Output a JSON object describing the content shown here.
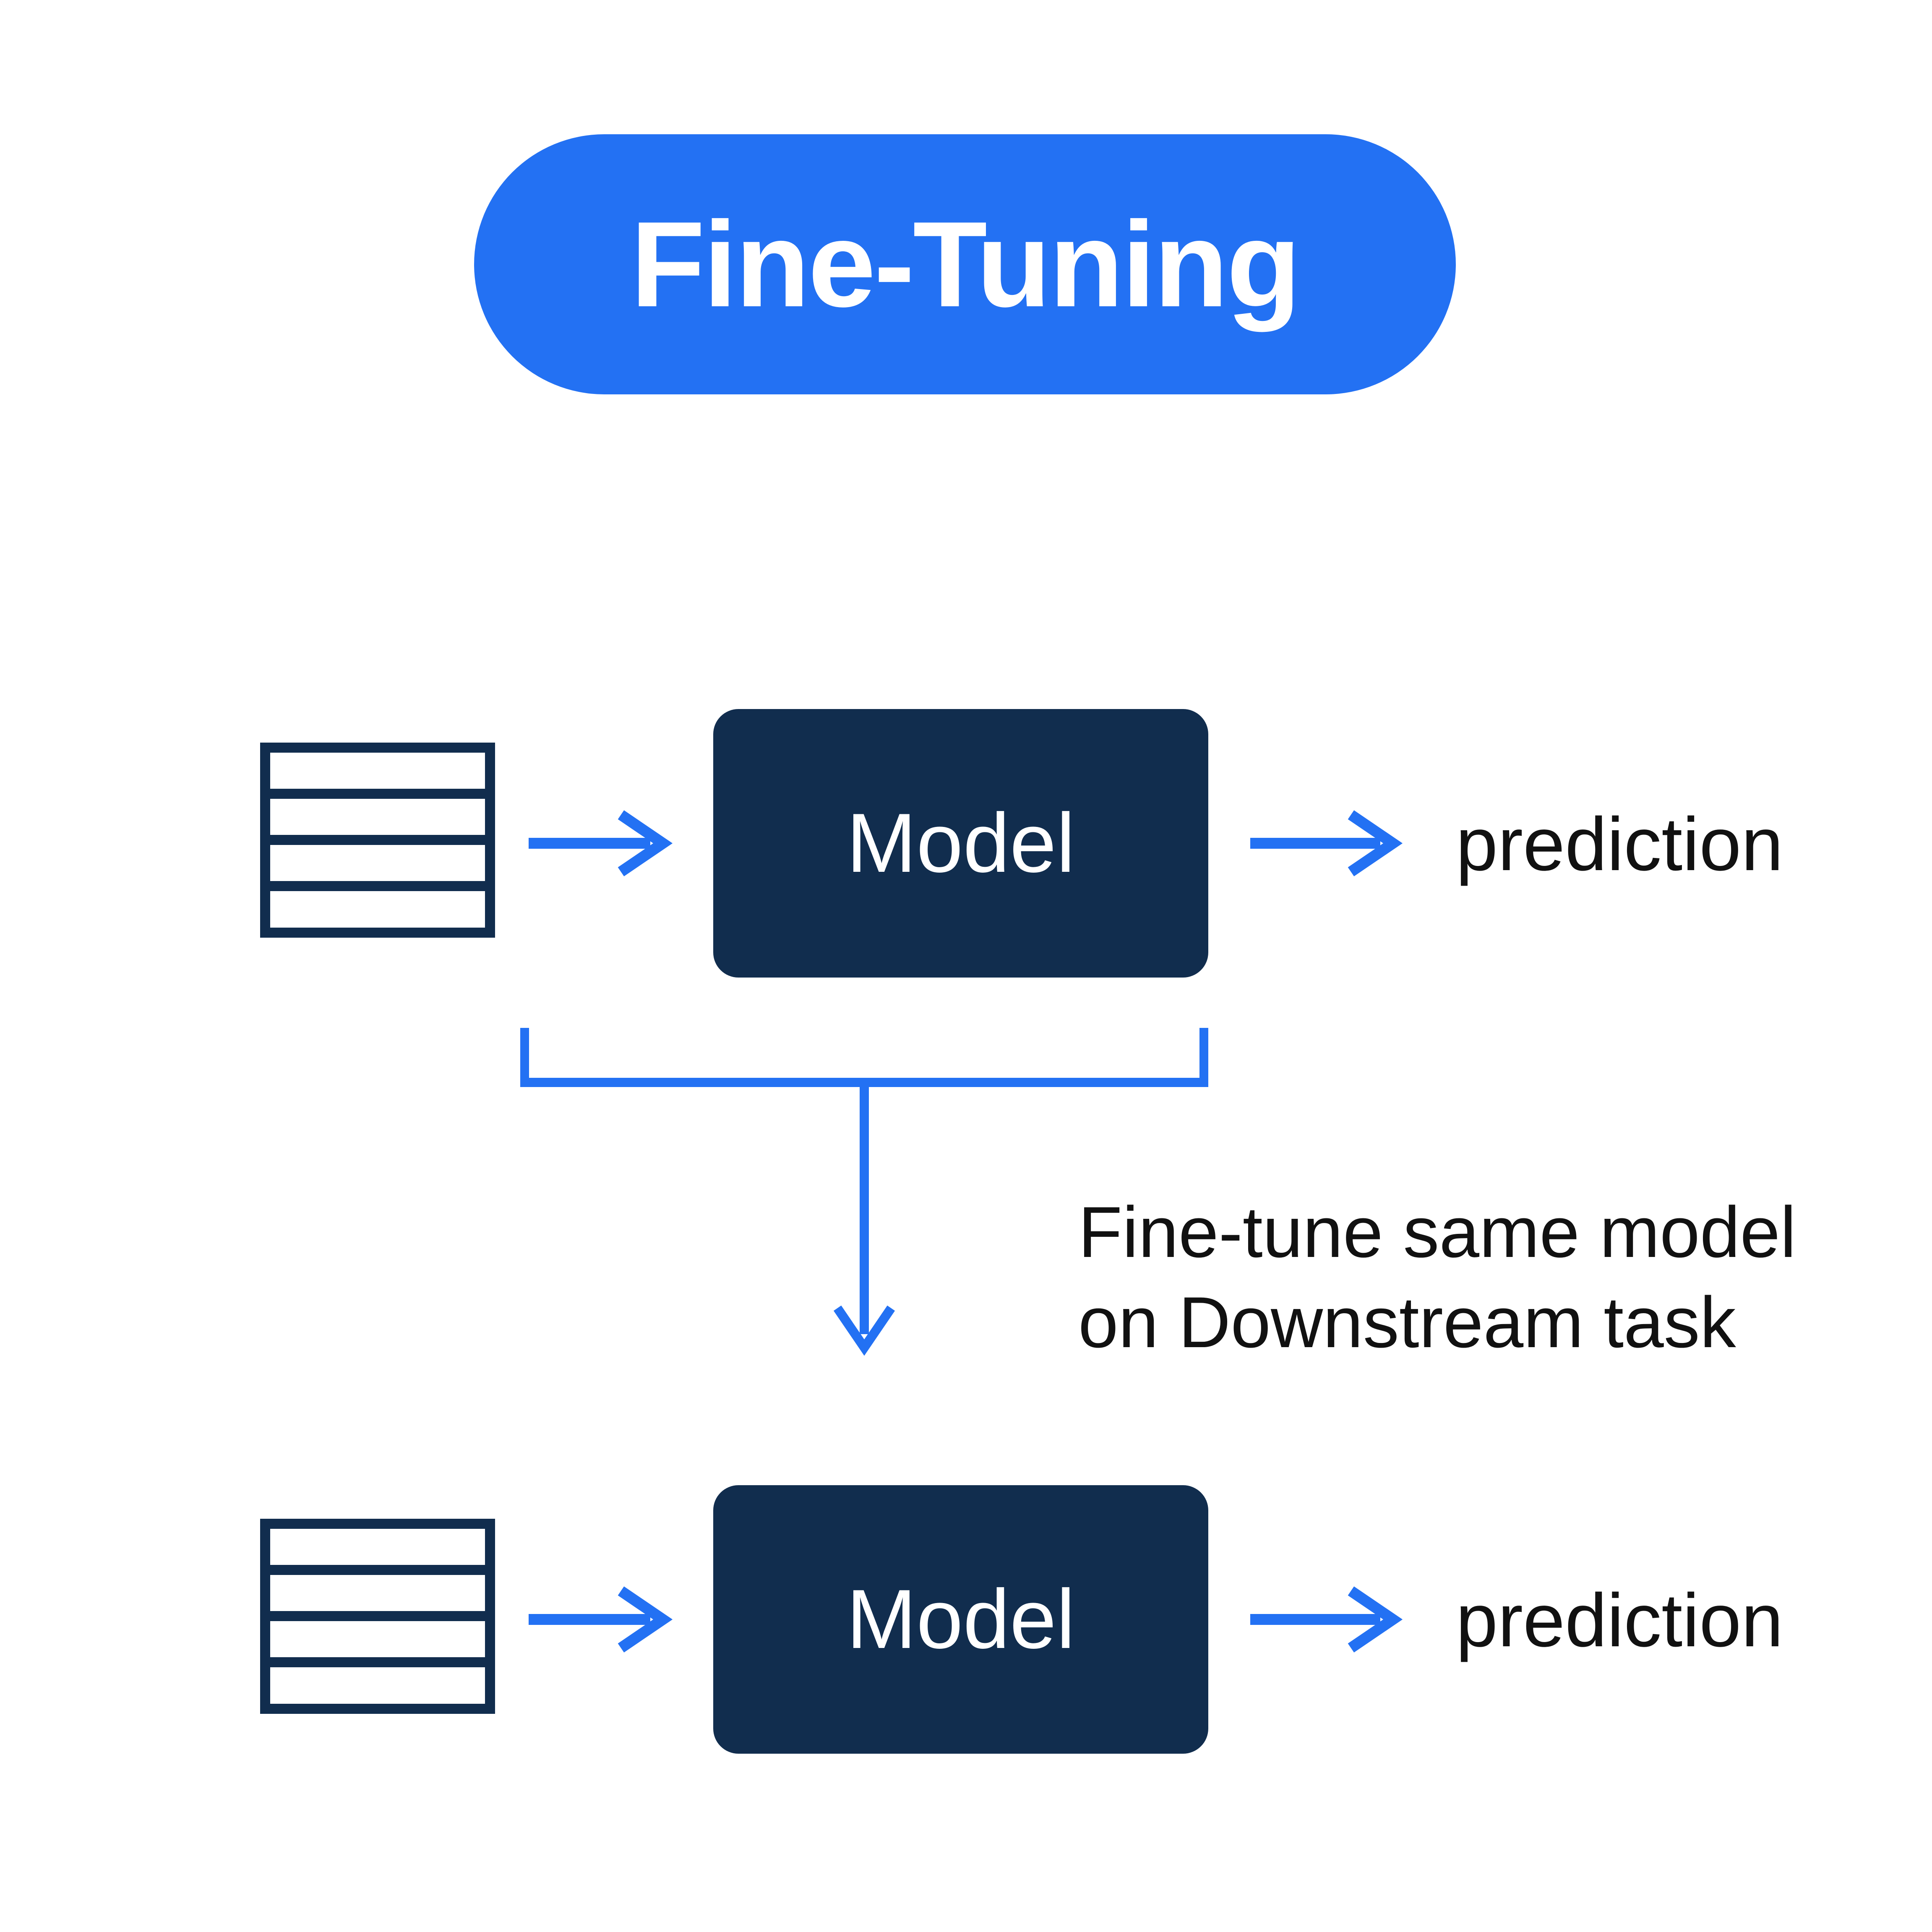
{
  "title": "Fine-Tuning",
  "colors": {
    "accent_blue": "#2371f3",
    "box_navy": "#112d4e",
    "icon_navy": "#112d4e",
    "text_black": "#111111"
  },
  "top_row": {
    "model_label": "Model",
    "output_label": "prediction"
  },
  "middle": {
    "caption_line1": "Fine-tune same model",
    "caption_line2": "on Downstream task"
  },
  "bottom_row": {
    "model_label": "Model",
    "output_label": "prediction"
  }
}
